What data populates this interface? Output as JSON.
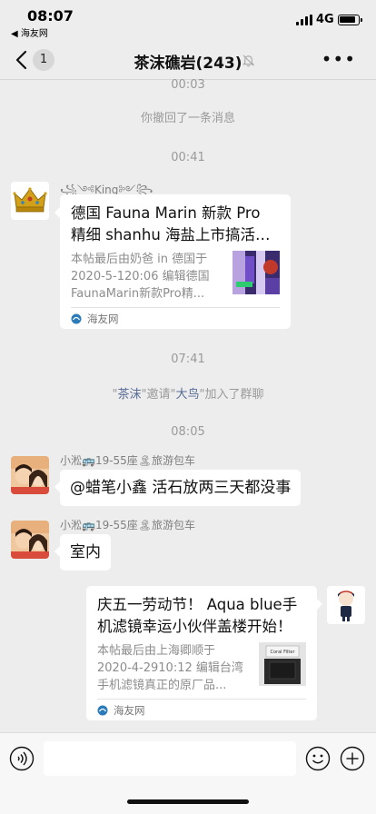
{
  "status": {
    "time": "08:07",
    "back_app": "◀ 海友网",
    "network": "4G"
  },
  "nav": {
    "unread": "1",
    "title": "茶沫礁岩(243)"
  },
  "messages": {
    "sys1": "00:03",
    "sys2": "你撤回了一条消息",
    "time2": "00:41",
    "king_name": "꧁༺King༻꧂",
    "card1": {
      "title": "德国 Fauna Marin 新款 Pro 精细 shanhu 海盐上市搞活动！...",
      "desc": "本帖最后由奶爸 in 德国于 2020-5-120:06 编辑德国 FaunaMarin新款Pro精...",
      "source": "海友网"
    },
    "time3": "07:41",
    "invite": {
      "q1": "\"",
      "who": "茶沫",
      "mid": "\"邀请\"",
      "whom": "大鸟",
      "end": "\"加入了群聊"
    },
    "time4": "08:05",
    "sender_name": "小淞🚌19-55座🏝旅游包车",
    "msg1": "@蜡笔小鑫 活石放两三天都没事",
    "msg2": "室内",
    "card2": {
      "title": "庆五一劳动节！ Aqua blue手机滤镜幸运小伙伴盖楼开始！",
      "desc": "本帖最后由上海卿顺于 2020-4-2910:12 编辑台湾手机滤镜真正的原厂品...",
      "thumb_label": "Coral Filter",
      "source": "海友网"
    }
  },
  "input": {
    "placeholder": ""
  },
  "colors": {
    "background": "#ededed",
    "link": "#576b95",
    "bubble": "#ffffff"
  }
}
